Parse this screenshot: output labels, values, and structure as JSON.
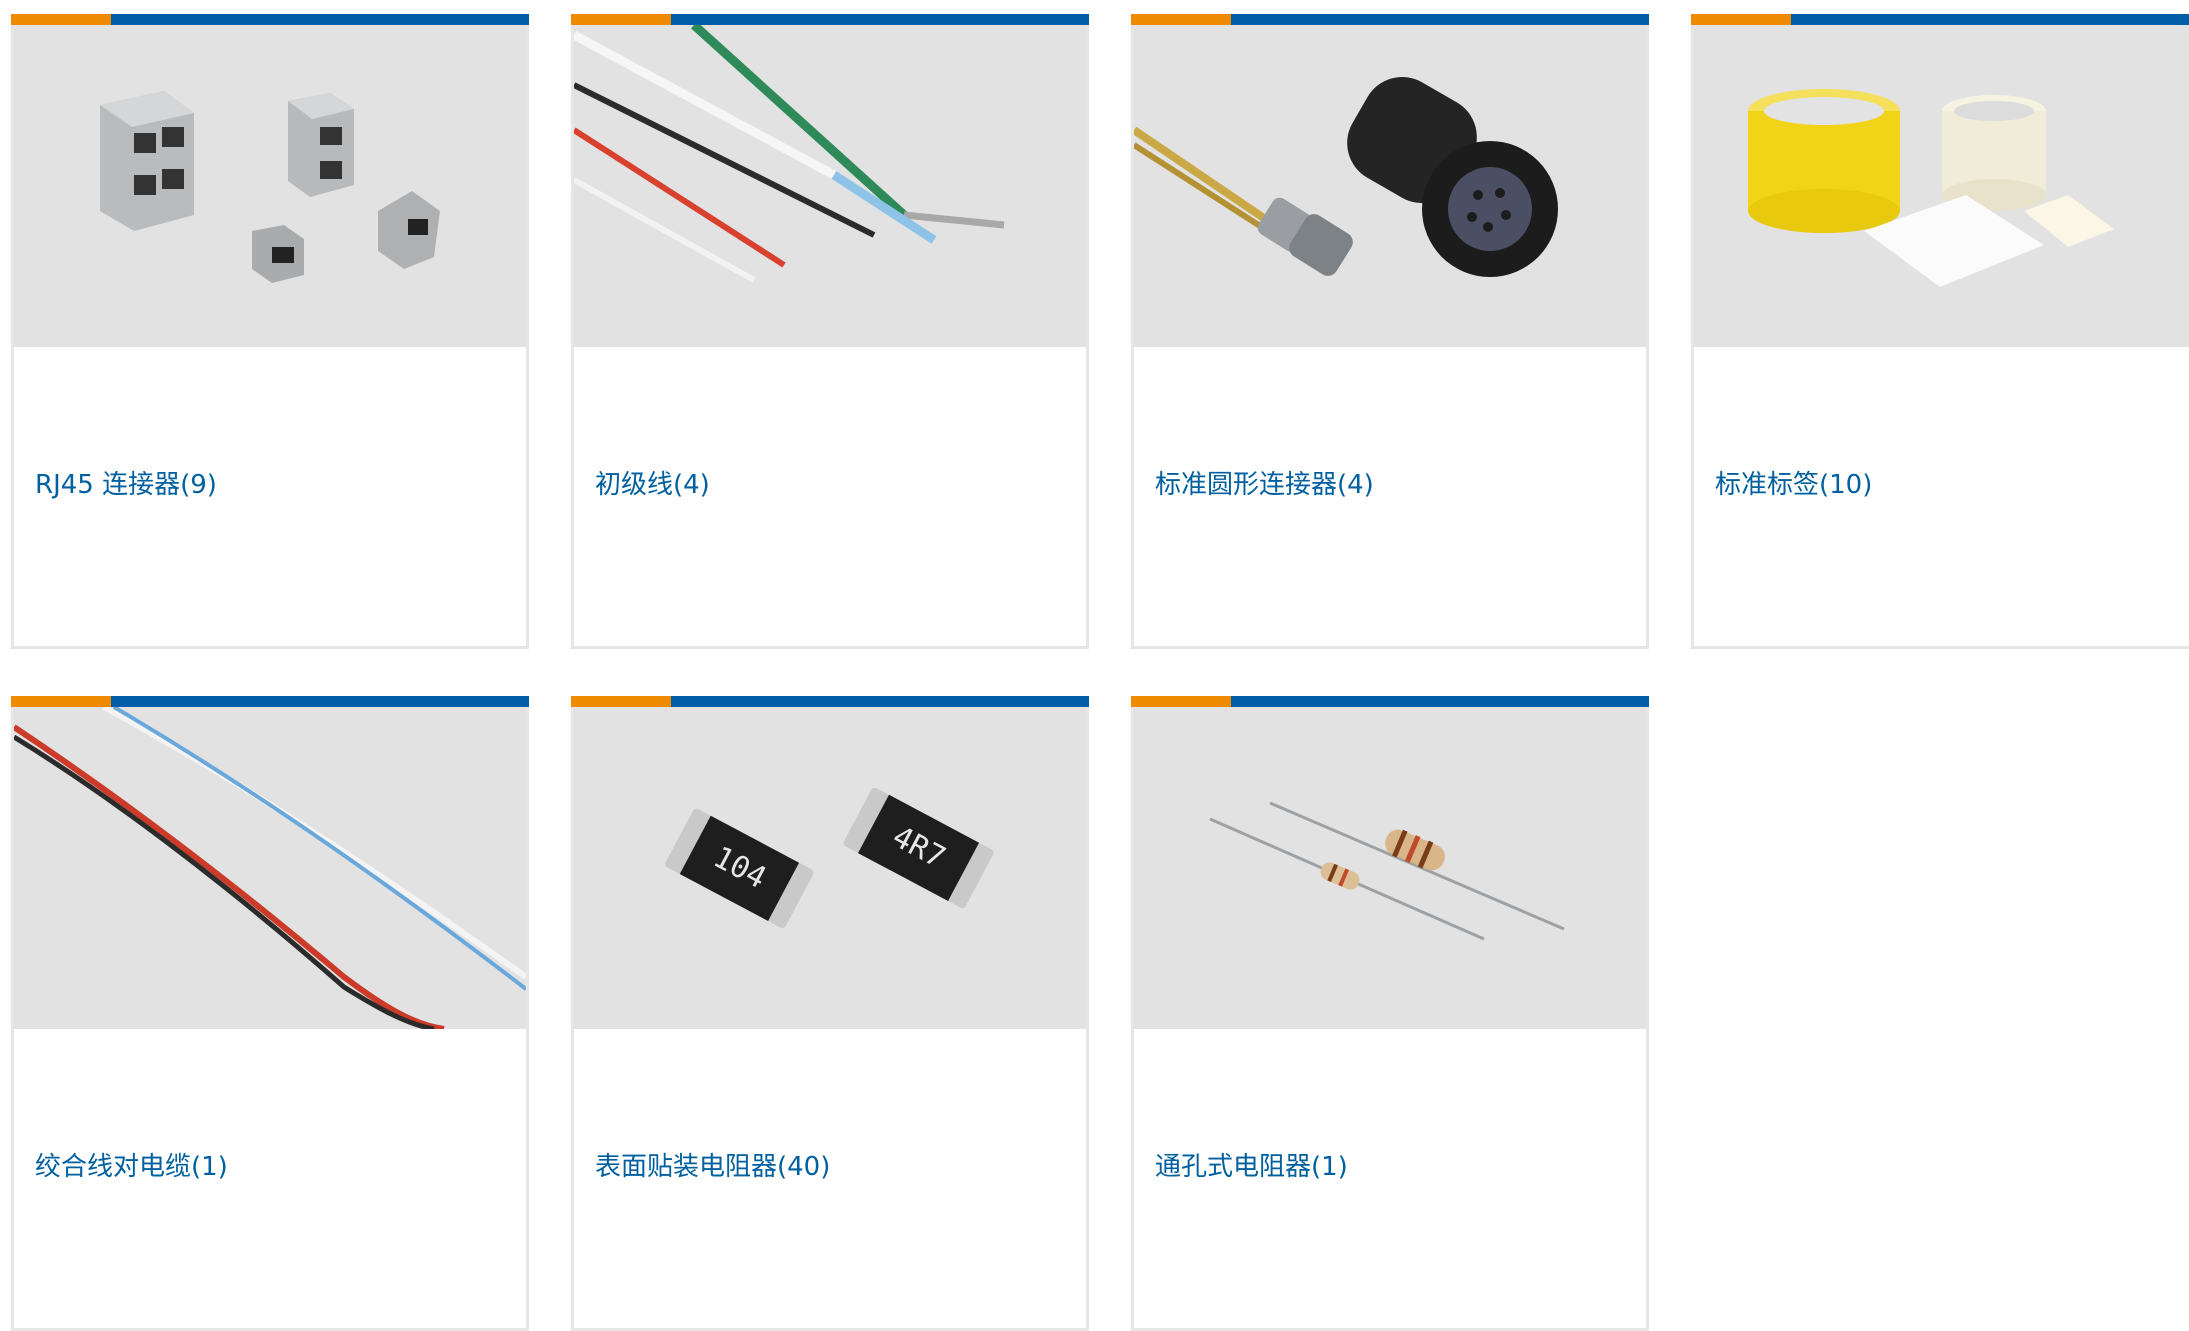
{
  "categories": [
    {
      "label": "RJ45 连接器(9)",
      "image_icon": "rj45-connectors-photo"
    },
    {
      "label": "初级线(4)",
      "image_icon": "hookup-wires-photo"
    },
    {
      "label": "标准圆形连接器(4)",
      "image_icon": "circular-connector-photo"
    },
    {
      "label": "标准标签(10)",
      "image_icon": "labels-photo"
    },
    {
      "label": "绞合线对电缆(1)",
      "image_icon": "twisted-pair-cable-photo"
    },
    {
      "label": "表面贴装电阻器(40)",
      "image_icon": "smd-resistors-photo"
    },
    {
      "label": "通孔式电阻器(1)",
      "image_icon": "through-hole-resistors-photo"
    }
  ],
  "colors": {
    "accent_orange": "#f08a00",
    "accent_blue": "#005ea8",
    "link_text": "#00609f",
    "image_bg": "#e2e2e2",
    "card_border": "#e6e6e6"
  },
  "photo_text": {
    "resistor_1": "104",
    "resistor_2": "4R7"
  }
}
